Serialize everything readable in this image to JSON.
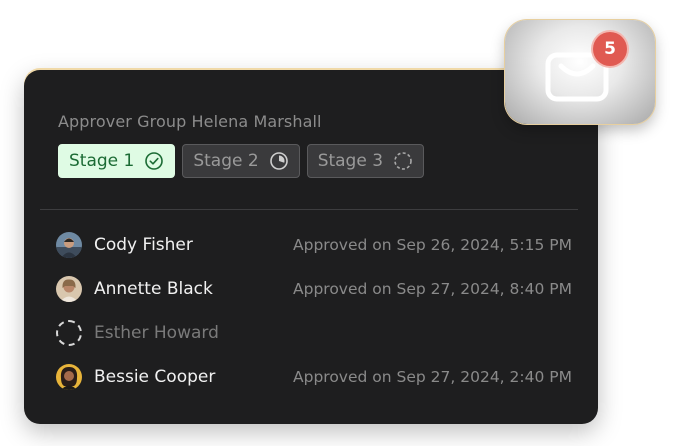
{
  "approver_group": {
    "title": "Approver Group Helena Marshall"
  },
  "stages": [
    {
      "label": "Stage 1",
      "state": "complete",
      "icon": "check-circle-icon"
    },
    {
      "label": "Stage 2",
      "state": "in-progress",
      "icon": "partial-circle-icon"
    },
    {
      "label": "Stage 3",
      "state": "pending",
      "icon": "dashed-circle-icon"
    }
  ],
  "approvers": [
    {
      "name": "Cody Fisher",
      "status": "Approved on Sep 26, 2024, 5:15 PM",
      "avatar": "photo"
    },
    {
      "name": "Annette Black",
      "status": "Approved on Sep 27, 2024, 8:40 PM",
      "avatar": "photo"
    },
    {
      "name": "Esther Howard",
      "status": "",
      "avatar": "dashed-circle"
    },
    {
      "name": "Bessie Cooper",
      "status": "Approved on Sep 27, 2024, 2:40 PM",
      "avatar": "photo"
    }
  ],
  "notification": {
    "count": "5",
    "icon": "mail-icon",
    "badge_color": "#e05a52"
  },
  "colors": {
    "card_bg": "#1e1e1f",
    "active_stage_bg": "#dffbe4",
    "active_stage_text": "#1b6b34"
  }
}
